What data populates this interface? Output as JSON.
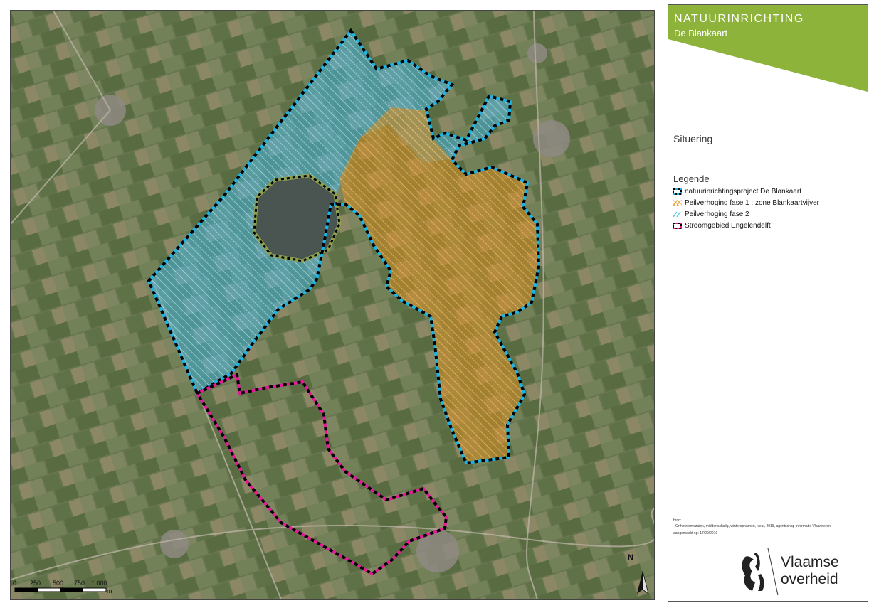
{
  "banner": {
    "title": "NATUURINRICHTING",
    "subtitle": "De Blankaart",
    "color": "#8db33a"
  },
  "section_title": "Situering",
  "legend": {
    "title": "Legende",
    "items": [
      {
        "label": "natuurinrichtingsproject De Blankaart",
        "swatch": "project-boundary",
        "color": "#1ab5e6"
      },
      {
        "label": "Peilverhoging fase 1 : zone Blankaartvijver",
        "swatch": "hatch",
        "color": "#f0a030"
      },
      {
        "label": "Peilverhoging fase 2",
        "swatch": "hatch",
        "color": "#55c8e8"
      },
      {
        "label": "Stroomgebied Engelendelft",
        "swatch": "boundary",
        "color": "#e8189a"
      }
    ]
  },
  "source": {
    "line1": "bron:",
    "line2": "- Orthofotomozaïek, middenschalig, winteropnamen, kleur, 2018, agentschap Informatie Vlaanderen",
    "line3": "aangemaakt op: 17/09/2019"
  },
  "logo": {
    "line1": "Vlaamse",
    "line2": "overheid",
    "icon": "flemish-lion-icon"
  },
  "scalebar": {
    "ticks": [
      "0",
      "250",
      "500",
      "750",
      "1.000"
    ],
    "unit": "m"
  },
  "north_arrow": {
    "label": "N",
    "icon": "north-arrow-icon"
  }
}
